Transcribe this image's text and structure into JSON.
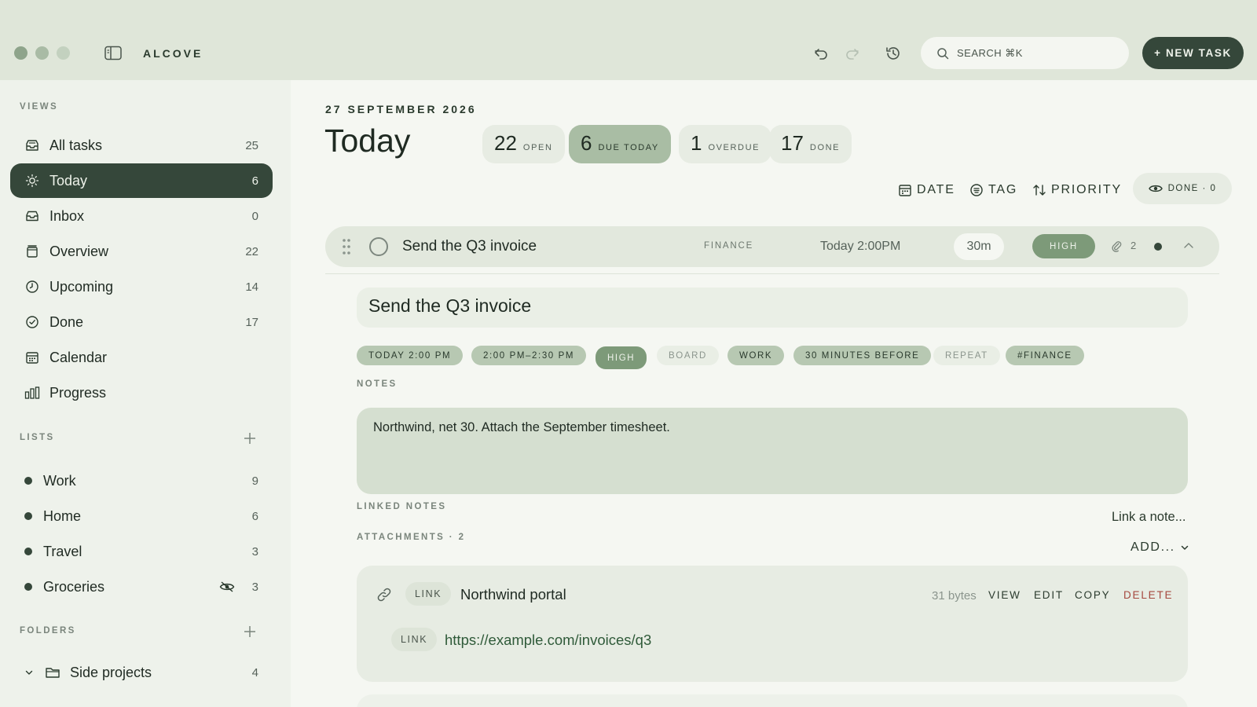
{
  "app": {
    "name": "ALCOVE"
  },
  "header": {
    "search_placeholder": "SEARCH ⌘K",
    "new_task_label": "+ NEW TASK"
  },
  "sidebar": {
    "views_label": "VIEWS",
    "views": [
      {
        "label": "All tasks",
        "count": "25",
        "icon": "inbox-stack-icon"
      },
      {
        "label": "Today",
        "count": "6",
        "icon": "sun-icon",
        "active": true
      },
      {
        "label": "Inbox",
        "count": "0",
        "icon": "inbox-icon"
      },
      {
        "label": "Overview",
        "count": "22",
        "icon": "archive-icon"
      },
      {
        "label": "Upcoming",
        "count": "14",
        "icon": "clock-icon"
      },
      {
        "label": "Done",
        "count": "17",
        "icon": "check-circle-icon"
      },
      {
        "label": "Calendar",
        "count": "",
        "icon": "calendar-icon"
      },
      {
        "label": "Progress",
        "count": "",
        "icon": "bar-chart-icon"
      }
    ],
    "lists_label": "LISTS",
    "lists": [
      {
        "label": "Work",
        "count": "9"
      },
      {
        "label": "Home",
        "count": "6"
      },
      {
        "label": "Travel",
        "count": "3"
      },
      {
        "label": "Groceries",
        "count": "3",
        "hidden": true
      }
    ],
    "folders_label": "FOLDERS",
    "folders": [
      {
        "label": "Side projects",
        "count": "4"
      }
    ]
  },
  "main": {
    "date": "27 SEPTEMBER 2026",
    "title": "Today",
    "stats": [
      {
        "num": "22",
        "label": "OPEN"
      },
      {
        "num": "6",
        "label": "DUE TODAY",
        "highlight": true
      },
      {
        "num": "1",
        "label": "OVERDUE"
      },
      {
        "num": "17",
        "label": "DONE"
      }
    ],
    "toolbar": {
      "date": "DATE",
      "tag": "TAG",
      "priority": "PRIORITY",
      "done_toggle": "DONE · 0"
    },
    "task": {
      "title": "Send the Q3 invoice",
      "list": "FINANCE",
      "due": "Today 2:00PM",
      "duration": "30m",
      "priority": "HIGH",
      "attachments": "2"
    },
    "detail": {
      "title": "Send the Q3 invoice",
      "chips": [
        "TODAY 2:00 PM",
        "2:00 PM–2:30 PM",
        "HIGH",
        "BOARD",
        "WORK",
        "30 MINUTES BEFORE",
        "REPEAT",
        "#FINANCE"
      ],
      "notes_label": "NOTES",
      "notes": "Northwind, net 30. Attach the September timesheet.",
      "linked_notes_label": "LINKED NOTES",
      "link_note": "Link a note...",
      "attachments_label": "ATTACHMENTS · 2",
      "add_label": "ADD...",
      "attachment": {
        "type": "LINK",
        "name": "Northwind portal",
        "size": "31 bytes",
        "actions": [
          "VIEW",
          "EDIT",
          "COPY",
          "DELETE"
        ],
        "url_type": "LINK",
        "url": "https://example.com/invoices/q3"
      }
    }
  },
  "colors": {
    "accent_dark": "#35473a",
    "accent_mid": "#7d9a79",
    "danger": "#a5483e",
    "topbar": "#dfe6d9"
  }
}
